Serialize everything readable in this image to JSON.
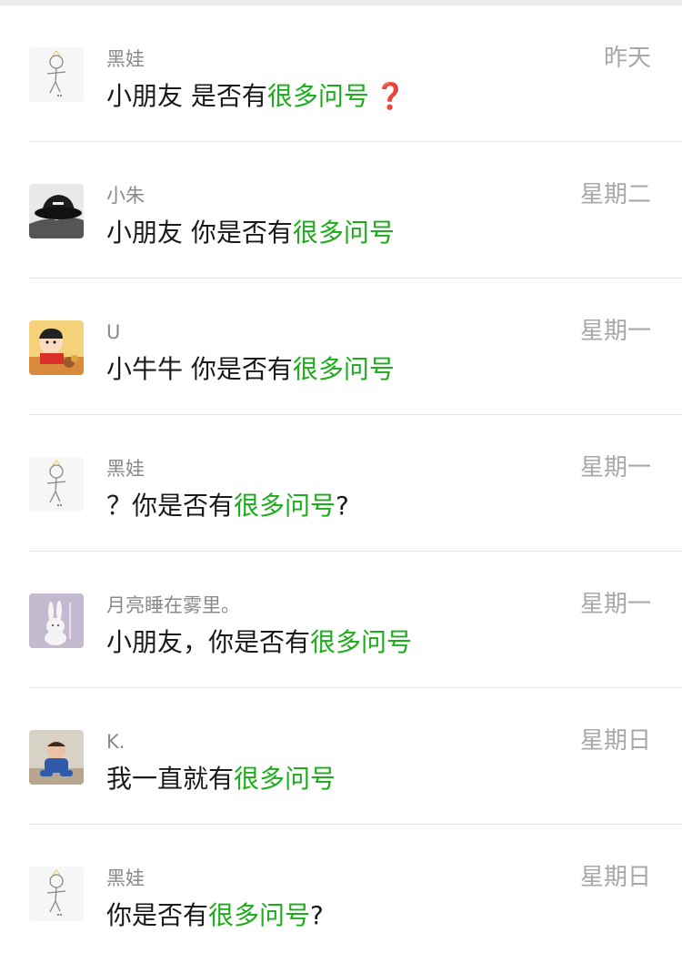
{
  "messages": [
    {
      "avatar": "stickman-avatar",
      "name": "黑娃",
      "pre": "小朋友 是否有",
      "hl": "很多问号",
      "post": "",
      "emoji": "❓",
      "time": "昨天"
    },
    {
      "avatar": "bucket-hat-avatar",
      "name": "小朱",
      "pre": "小朋友 你是否有",
      "hl": "很多问号",
      "post": "",
      "emoji": "",
      "time": "星期二"
    },
    {
      "avatar": "cartoon-kid-avatar",
      "name": "U",
      "pre": "小牛牛 你是否有",
      "hl": "很多问号",
      "post": "",
      "emoji": "",
      "time": "星期一"
    },
    {
      "avatar": "stickman-avatar",
      "name": "黑娃",
      "pre": "？你是否有",
      "hl": "很多问号",
      "post": "?",
      "emoji": "",
      "time": "星期一"
    },
    {
      "avatar": "bunny-avatar",
      "name": "月亮睡在雾里。",
      "pre": "小朋友，你是否有",
      "hl": "很多问号",
      "post": "",
      "emoji": "",
      "time": "星期一"
    },
    {
      "avatar": "baby-photo-avatar",
      "name": "K.",
      "pre": "我一直就有",
      "hl": "很多问号",
      "post": "",
      "emoji": "",
      "time": "星期日"
    },
    {
      "avatar": "stickman-avatar",
      "name": "黑娃",
      "pre": "你是否有",
      "hl": "很多问号",
      "post": "?",
      "emoji": "",
      "time": "星期日"
    }
  ],
  "colors": {
    "highlight": "#1aad19",
    "name": "#8a8a8a",
    "time": "#a8a8a8",
    "text": "#1a1a1a"
  }
}
